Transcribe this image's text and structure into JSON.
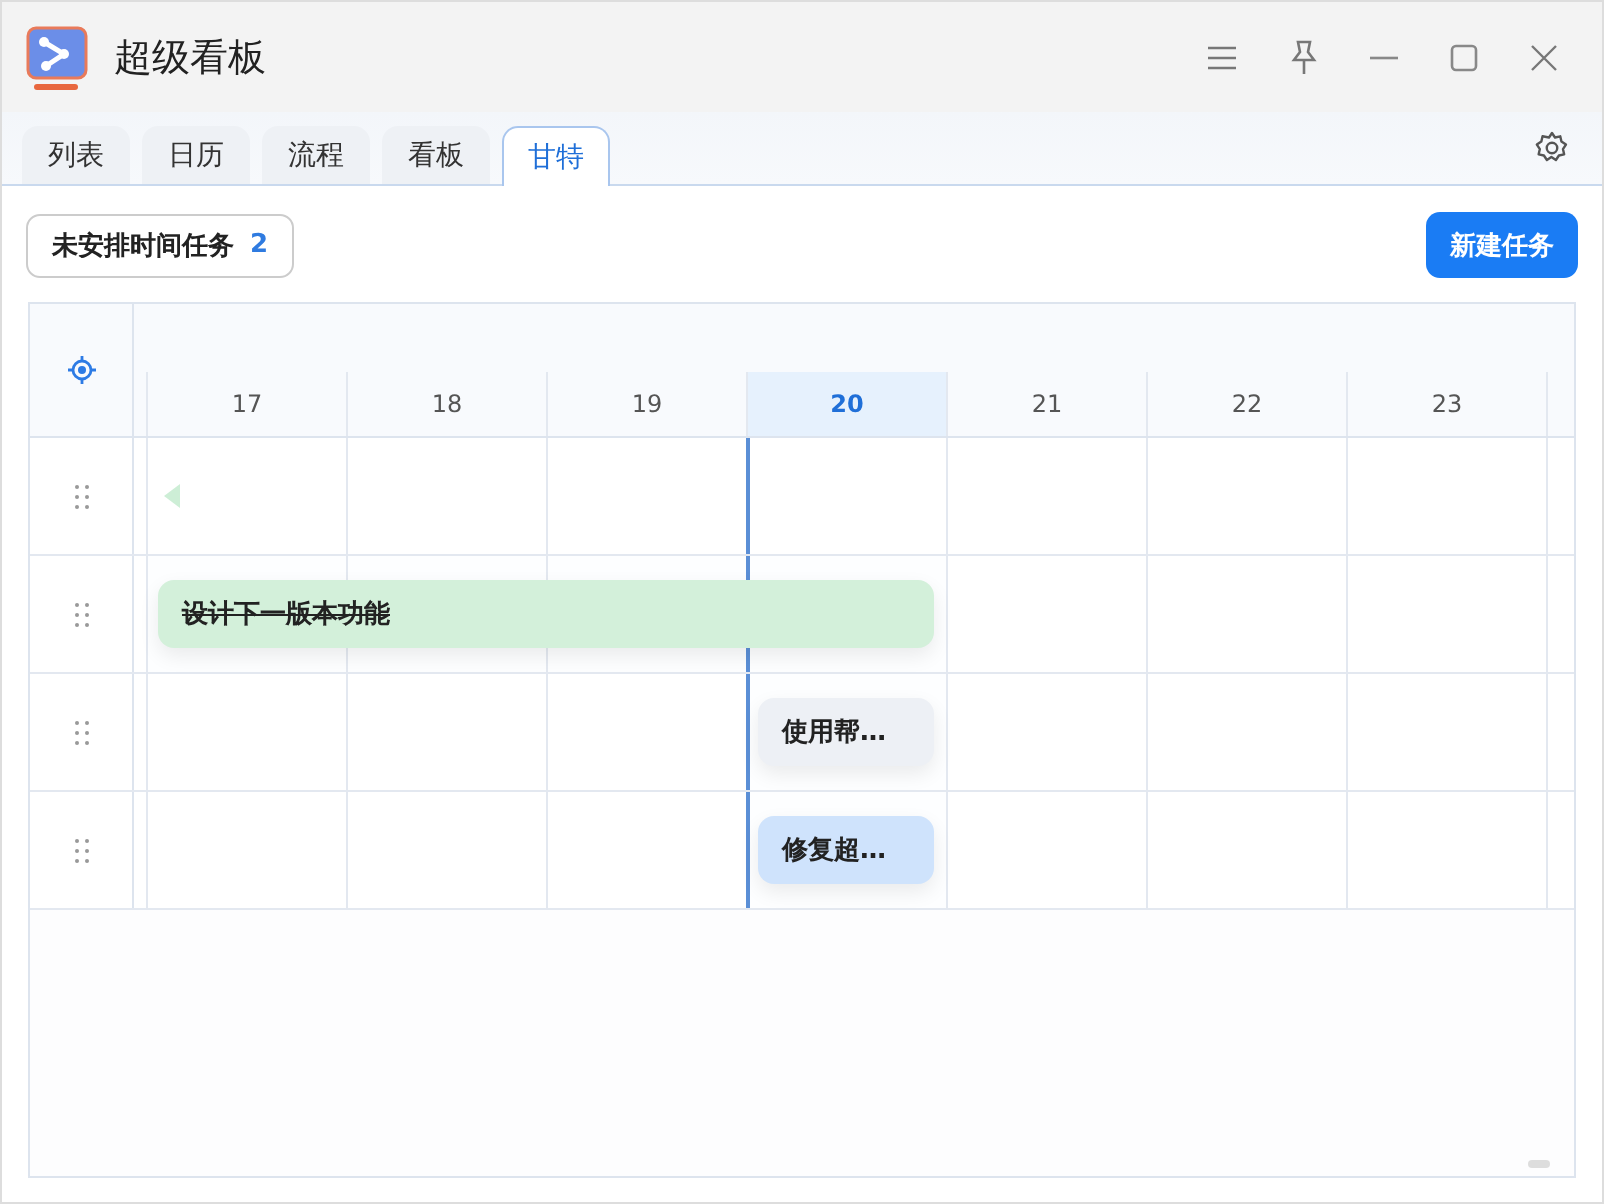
{
  "window": {
    "title": "超级看板"
  },
  "tabs": [
    {
      "label": "列表",
      "selected": false
    },
    {
      "label": "日历",
      "selected": false
    },
    {
      "label": "流程",
      "selected": false
    },
    {
      "label": "看板",
      "selected": false
    },
    {
      "label": "甘特",
      "selected": true
    }
  ],
  "toolbar": {
    "unscheduled": {
      "label": "未安排时间任务",
      "count": "2"
    },
    "new_task": "新建任务"
  },
  "gantt": {
    "days": [
      {
        "label": "17",
        "today": false
      },
      {
        "label": "18",
        "today": false
      },
      {
        "label": "19",
        "today": false
      },
      {
        "label": "20",
        "today": true
      },
      {
        "label": "21",
        "today": false
      },
      {
        "label": "22",
        "today": false
      },
      {
        "label": "23",
        "today": false
      }
    ],
    "rows": [
      {
        "kind": "marker",
        "color": "#cdeed6"
      },
      {
        "kind": "bar",
        "label": "设计下一版本功能",
        "done": true,
        "color": "#d3f0da",
        "covers": [
          true,
          true,
          true,
          true,
          false,
          false,
          false
        ]
      },
      {
        "kind": "bar",
        "label": "使用帮…",
        "done": false,
        "color": "#edf0f5",
        "covers": [
          false,
          false,
          false,
          true,
          false,
          false,
          false
        ]
      },
      {
        "kind": "bar",
        "label": "修复超…",
        "done": false,
        "color": "#cfe3fc",
        "covers": [
          false,
          false,
          false,
          true,
          false,
          false,
          false
        ]
      }
    ]
  }
}
